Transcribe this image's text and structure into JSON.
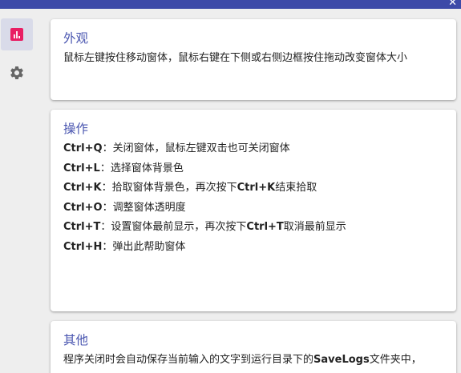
{
  "colors": {
    "titlebar": "#3d4aa8",
    "accent": "#4a56b0",
    "active_nav": "#e91e63",
    "icon_gray": "#666666"
  },
  "titlebar": {
    "close_icon": "close-icon"
  },
  "sidebar": {
    "items": [
      {
        "icon": "bar-chart-icon",
        "active": true
      },
      {
        "icon": "gear-icon",
        "active": false
      }
    ]
  },
  "sections": {
    "appearance": {
      "title": "外观",
      "text": "鼠标左键按住移动窗体，鼠标右键在下侧或右侧边框按住拖动改变窗体大小"
    },
    "operations": {
      "title": "操作",
      "shortcuts": [
        {
          "key": "Ctrl+Q",
          "desc": "：关闭窗体，鼠标左键双击也可关闭窗体"
        },
        {
          "key": "Ctrl+L",
          "desc": "：选择窗体背景色"
        },
        {
          "key": "Ctrl+K",
          "desc": "：拾取窗体背景色，再次按下",
          "key2": "Ctrl+K",
          "desc2": "结束拾取"
        },
        {
          "key": "Ctrl+O",
          "desc": "：调整窗体透明度"
        },
        {
          "key": "Ctrl+T",
          "desc": "：设置窗体最前显示，再次按下",
          "key2": "Ctrl+T",
          "desc2": "取消最前显示"
        },
        {
          "key": "Ctrl+H",
          "desc": "：弹出此帮助窗体"
        }
      ]
    },
    "other": {
      "title": "其他",
      "text_before": "程序关闭时会自动保存当前输入的文字到运行目录下的",
      "text_bold": "SaveLogs",
      "text_after": "文件夹中，"
    }
  }
}
